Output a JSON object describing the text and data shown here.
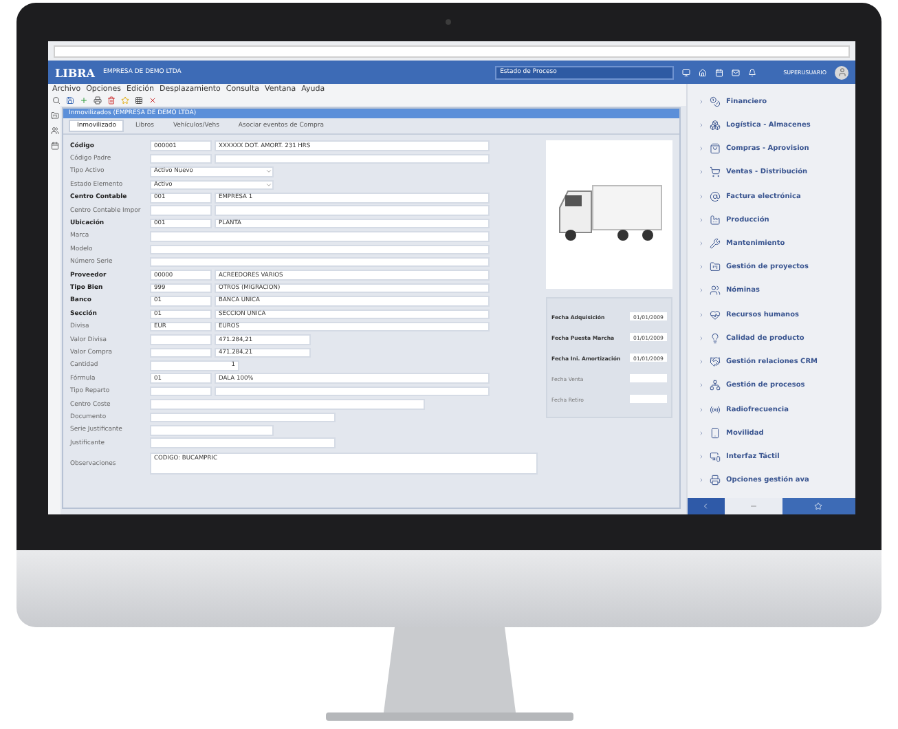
{
  "header": {
    "logo": "LIBRA",
    "company": "EMPRESA DE DEMO LTDA",
    "search": "Estado de Proceso",
    "user": "SUPERUSUARIO"
  },
  "menu": [
    "Archivo",
    "Opciones",
    "Edición",
    "Desplazamiento",
    "Consulta",
    "Ventana",
    "Ayuda"
  ],
  "window": {
    "title": "Inmovilizados (EMPRESA DE DEMO LTDA)"
  },
  "tabs": [
    {
      "label": "Inmovilizado",
      "selected": true
    },
    {
      "label": "Libros",
      "selected": false
    },
    {
      "label": "Vehículos/Vehs",
      "selected": false
    },
    {
      "label": "Asociar eventos de Compra",
      "selected": false
    }
  ],
  "fields": [
    {
      "label": "Código",
      "bold": true,
      "kind": "pair",
      "code": "000001",
      "description": "XXXXXX DOT. AMORT. 231 HRS"
    },
    {
      "label": "Código Padre",
      "bold": false,
      "kind": "pair"
    },
    {
      "label": "Tipo Activo",
      "bold": false,
      "kind": "select",
      "code": "Activo Nuevo"
    },
    {
      "label": "Estado Elemento",
      "bold": false,
      "kind": "select",
      "code": "Activo"
    },
    {
      "label": "Centro Contable",
      "bold": true,
      "kind": "pair",
      "code": "001",
      "description": "EMPRESA 1"
    },
    {
      "label": "Centro Contable Impor",
      "bold": false,
      "kind": "pair"
    },
    {
      "label": "Ubicación",
      "bold": true,
      "kind": "pair",
      "code": "001",
      "description": "PLANTA"
    },
    {
      "label": "Marca",
      "bold": false,
      "kind": "long"
    },
    {
      "label": "Modelo",
      "bold": false,
      "kind": "long"
    },
    {
      "label": "Número Serie",
      "bold": false,
      "kind": "long"
    },
    {
      "label": "Proveedor",
      "bold": true,
      "kind": "pair",
      "code": "00000",
      "description": "ACREEDORES VARIOS"
    },
    {
      "label": "Tipo Bien",
      "bold": true,
      "kind": "pair",
      "code": "999",
      "description": "OTROS (MIGRACION)"
    },
    {
      "label": "Banco",
      "bold": true,
      "kind": "pair",
      "code": "01",
      "description": "BANCA UNICA"
    },
    {
      "label": "Sección",
      "bold": true,
      "kind": "pair",
      "code": "01",
      "description": "SECCION UNICA"
    },
    {
      "label": "Divisa",
      "bold": false,
      "kind": "pair",
      "code": "EUR",
      "description": "EUROS"
    },
    {
      "label": "Valor Divisa",
      "bold": false,
      "kind": "amount",
      "description": "471.284,21"
    },
    {
      "label": "Valor Compra",
      "bold": false,
      "kind": "amount",
      "description": "471.284,21"
    },
    {
      "label": "Cantidad",
      "bold": false,
      "kind": "count",
      "code": "1"
    },
    {
      "label": "Fórmula",
      "bold": false,
      "kind": "pair",
      "code": "01",
      "description": "DALA 100%"
    },
    {
      "label": "Tipo Reparto",
      "bold": false,
      "kind": "pair"
    },
    {
      "label": "Centro Coste",
      "bold": false,
      "kind": "wide"
    },
    {
      "label": "Documento",
      "bold": false,
      "kind": "medium"
    },
    {
      "label": "Serie Justificante",
      "bold": false,
      "kind": "short"
    },
    {
      "label": "Justificante",
      "bold": false,
      "kind": "medium"
    }
  ],
  "observations": {
    "label": "Observaciones",
    "value": "CODIGO: BUCAMPRIC"
  },
  "dates": [
    {
      "label": "Fecha Adquisición",
      "bold": true,
      "value": "01/01/2009"
    },
    {
      "label": "Fecha Puesta Marcha",
      "bold": true,
      "value": "01/01/2009"
    },
    {
      "label": "Fecha Ini. Amortización",
      "bold": true,
      "value": "01/01/2009"
    },
    {
      "label": "Fecha Venta",
      "bold": false
    },
    {
      "label": "Fecha Retiro",
      "bold": false
    }
  ],
  "modules": [
    {
      "label": "Financiero",
      "kind": "coin"
    },
    {
      "label": "Logística - Almacenes",
      "kind": "box"
    },
    {
      "label": "Compras - Aprovision",
      "kind": "bag"
    },
    {
      "label": "Ventas - Distribución",
      "kind": "cart"
    },
    {
      "label": "Factura electrónica",
      "kind": "at"
    },
    {
      "label": "Producción",
      "kind": "factory"
    },
    {
      "label": "Mantenimiento",
      "kind": "tools"
    },
    {
      "label": "Gestión de proyectos",
      "kind": "folder"
    },
    {
      "label": "Nóminas",
      "kind": "users"
    },
    {
      "label": "Recursos humanos",
      "kind": "heart"
    },
    {
      "label": "Calidad de producto",
      "kind": "bulb"
    },
    {
      "label": "Gestión relaciones CRM",
      "kind": "handshake"
    },
    {
      "label": "Gestión de procesos",
      "kind": "network"
    },
    {
      "label": "Radiofrecuencia",
      "kind": "radio"
    },
    {
      "label": "Movilidad",
      "kind": "phone"
    },
    {
      "label": "Interfaz Táctil",
      "kind": "touch"
    },
    {
      "label": "Opciones gestión ava",
      "kind": "printer"
    }
  ]
}
